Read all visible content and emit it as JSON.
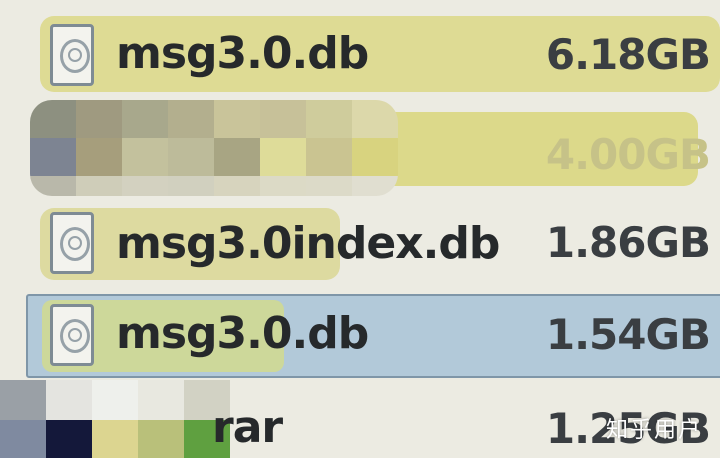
{
  "files": [
    {
      "name": "msg3.0.db",
      "size": "6.18GB",
      "icon": "database-file-icon"
    },
    {
      "name": "",
      "size": "4.00GB",
      "icon": ""
    },
    {
      "name": "msg3.0index.db",
      "size": "1.86GB",
      "icon": "database-file-icon"
    },
    {
      "name": "msg3.0.db",
      "size": "1.54GB",
      "icon": "database-file-icon",
      "selected": true
    },
    {
      "name": "rar",
      "size": "1.25GB",
      "icon": ""
    }
  ],
  "watermark": "知乎用户",
  "colors": {
    "background": "#ecebe2",
    "text_highlight": "#dedb94",
    "selection": "#b2c9d9",
    "selection_border": "#7f96a8"
  }
}
